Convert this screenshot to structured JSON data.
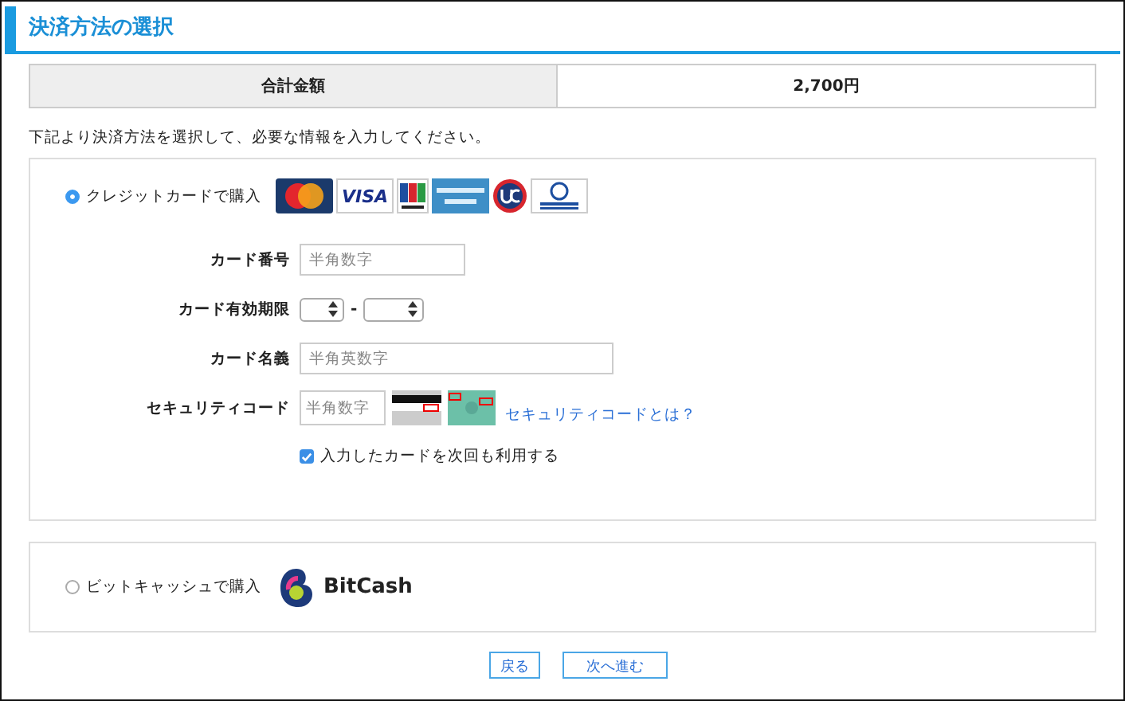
{
  "page_title": "決済方法の選択",
  "total": {
    "label": "合計金額",
    "value": "2,700円"
  },
  "instruction": "下記より決済方法を選択して、必要な情報を入力してください。",
  "credit": {
    "label": "クレジットカードで購入",
    "selected": true,
    "card_logos": [
      {
        "kind": "mastercard"
      },
      {
        "kind": "visa",
        "text": "VISA"
      },
      {
        "kind": "jcb"
      },
      {
        "kind": "amex"
      },
      {
        "kind": "uc"
      },
      {
        "kind": "diners"
      }
    ],
    "fields": [
      {
        "kind": "number",
        "label": "カード番号",
        "placeholder": "半角数字"
      },
      {
        "kind": "expiry",
        "label": "カード有効期限",
        "separator": "-"
      },
      {
        "kind": "name",
        "label": "カード名義",
        "placeholder": "半角英数字"
      },
      {
        "kind": "security",
        "label": "セキュリティコード",
        "placeholder": "半角数字",
        "link": "セキュリティコードとは？"
      }
    ],
    "remember": {
      "label": "入力したカードを次回も利用する",
      "checked": true
    }
  },
  "bitcash": {
    "label": "ビットキャッシュで購入",
    "selected": false,
    "logo_text": "BitCash"
  },
  "buttons": [
    "戻る",
    "次へ進む"
  ]
}
